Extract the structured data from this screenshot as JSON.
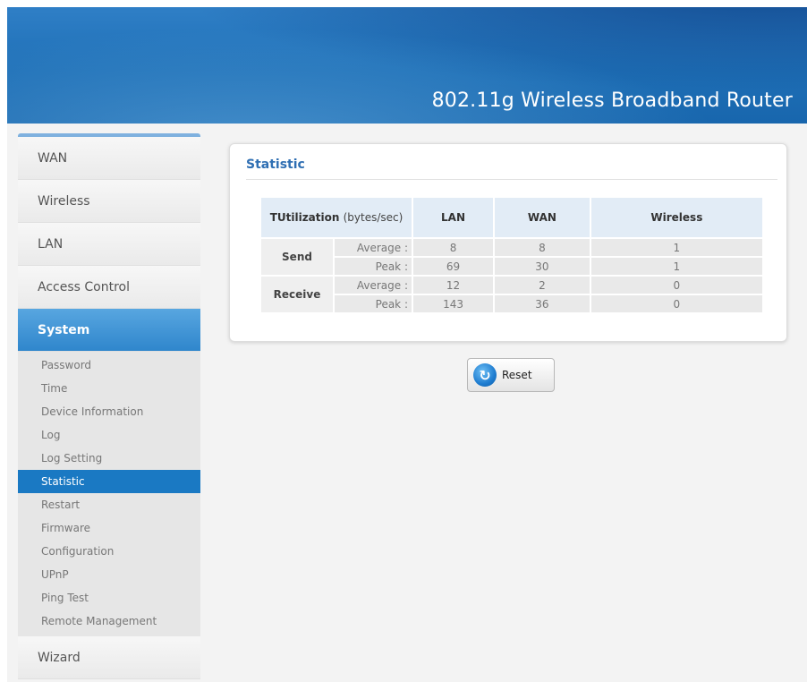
{
  "header": {
    "title": "802.11g Wireless Broadband Router"
  },
  "sidebar": {
    "items": [
      {
        "label": "WAN"
      },
      {
        "label": "Wireless"
      },
      {
        "label": "LAN"
      },
      {
        "label": "Access Control"
      },
      {
        "label": "System"
      },
      {
        "label": "Wizard"
      }
    ],
    "active_section": "System",
    "submenu": [
      {
        "label": "Password"
      },
      {
        "label": "Time"
      },
      {
        "label": "Device Information"
      },
      {
        "label": "Log"
      },
      {
        "label": "Log Setting"
      },
      {
        "label": "Statistic"
      },
      {
        "label": "Restart"
      },
      {
        "label": "Firmware"
      },
      {
        "label": "Configuration"
      },
      {
        "label": "UPnP"
      },
      {
        "label": "Ping Test"
      },
      {
        "label": "Remote Management"
      }
    ],
    "active_submenu": "Statistic"
  },
  "panel": {
    "title": "Statistic",
    "table": {
      "head_label": "TUtilization",
      "head_unit": "(bytes/sec)",
      "columns": [
        "LAN",
        "WAN",
        "Wireless"
      ],
      "groups": [
        {
          "label": "Send",
          "rows": [
            {
              "label": "Average :",
              "values": [
                "8",
                "8",
                "1"
              ]
            },
            {
              "label": "Peak :",
              "values": [
                "69",
                "30",
                "1"
              ]
            }
          ]
        },
        {
          "label": "Receive",
          "rows": [
            {
              "label": "Average :",
              "values": [
                "12",
                "2",
                "0"
              ]
            },
            {
              "label": "Peak :",
              "values": [
                "143",
                "36",
                "0"
              ]
            }
          ]
        }
      ]
    }
  },
  "actions": {
    "reset_label": "Reset",
    "reset_icon": "refresh-icon"
  },
  "colors": {
    "header_blue": "#1e6fb6",
    "active_blue": "#1a79c3",
    "title_blue": "#2f6fb3"
  }
}
